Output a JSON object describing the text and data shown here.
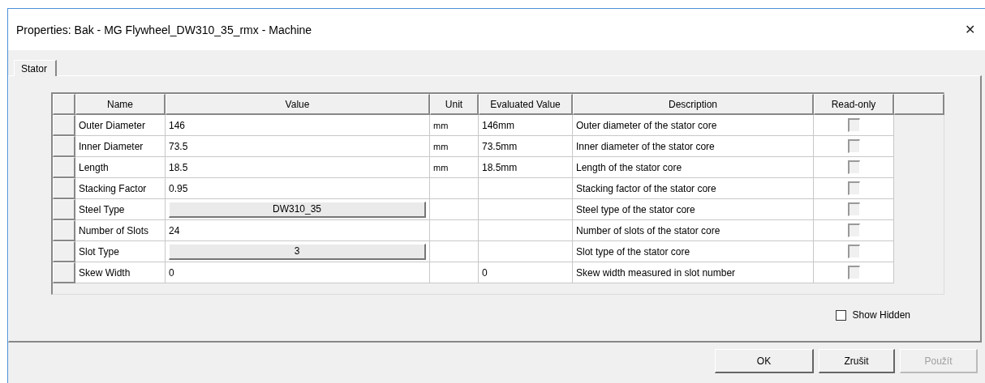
{
  "window": {
    "title": "Properties: Bak - MG Flywheel_DW310_35_rmx - Machine",
    "close": "✕"
  },
  "tabs": [
    {
      "label": "Stator",
      "selected": true
    }
  ],
  "table": {
    "columns": [
      "Name",
      "Value",
      "Unit",
      "Evaluated Value",
      "Description",
      "Read-only"
    ],
    "rows": [
      {
        "name": "Outer Diameter",
        "value": "146",
        "kind": "text",
        "unit": "mm",
        "evaluated": "146mm",
        "description": "Outer diameter of the stator core",
        "read_only": false,
        "disabled": true
      },
      {
        "name": "Inner Diameter",
        "value": "73.5",
        "kind": "text",
        "unit": "mm",
        "evaluated": "73.5mm",
        "description": "Inner diameter of the stator core",
        "read_only": false,
        "disabled": true
      },
      {
        "name": "Length",
        "value": "18.5",
        "kind": "text",
        "unit": "mm",
        "evaluated": "18.5mm",
        "description": "Length of the stator core",
        "read_only": false,
        "disabled": true
      },
      {
        "name": "Stacking Factor",
        "value": "0.95",
        "kind": "text",
        "description": "Stacking factor of the stator core",
        "read_only": false,
        "disabled": true
      },
      {
        "name": "Steel Type",
        "value": "DW310_35",
        "kind": "button",
        "description": "Steel type of the stator core",
        "read_only": false,
        "disabled": true
      },
      {
        "name": "Number of Slots",
        "value": "24",
        "kind": "text",
        "description": "Number of slots of the stator core",
        "read_only": false,
        "disabled": true
      },
      {
        "name": "Slot Type",
        "value": "3",
        "kind": "button",
        "description": "Slot type of the stator core",
        "read_only": false,
        "disabled": true
      },
      {
        "name": "Skew Width",
        "value": "0",
        "kind": "text",
        "evaluated": "0",
        "description": "Skew width measured in slot number",
        "read_only": false,
        "disabled": true
      }
    ]
  },
  "show_hidden": {
    "label": "Show Hidden",
    "checked": false
  },
  "buttons": [
    {
      "label": "OK",
      "disabled": false
    },
    {
      "label": "Zrušit",
      "disabled": false
    },
    {
      "label": "Použít",
      "disabled": true
    }
  ]
}
